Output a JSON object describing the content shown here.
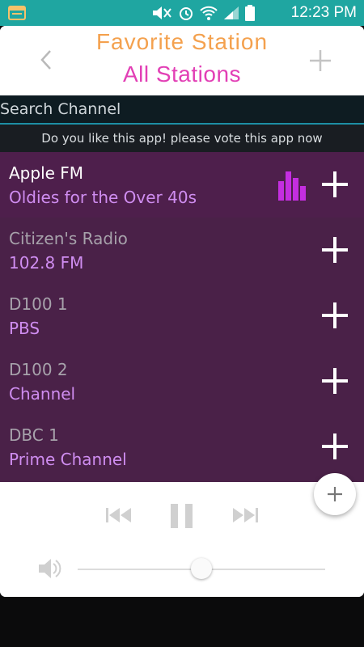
{
  "status_bar": {
    "time": "12:23 PM"
  },
  "header": {
    "title": "Favorite Station",
    "subtitle": "All Stations"
  },
  "search": {
    "placeholder": "Search Channel"
  },
  "vote_banner": "Do you like this app! please vote this app now",
  "stations": [
    {
      "name": "Apple FM",
      "subtitle": "Oldies for the Over 40s",
      "playing": true
    },
    {
      "name": "Citizen's Radio",
      "subtitle": "102.8 FM",
      "playing": false
    },
    {
      "name": "D100 1",
      "subtitle": "PBS",
      "playing": false
    },
    {
      "name": "D100 2",
      "subtitle": "Channel",
      "playing": false
    },
    {
      "name": "DBC 1",
      "subtitle": "Prime Channel",
      "playing": false
    }
  ],
  "player": {
    "volume": 0.5
  },
  "colors": {
    "status_bar": "#1fa6a1",
    "title_orange": "#f4a14e",
    "title_pink": "#e23fb5",
    "list_bg": "#4a2148",
    "subtitle_purple": "#cf8df0",
    "equalizer": "#c42ee0"
  },
  "icons": {
    "back": "chevron-left-icon",
    "add": "plus-icon",
    "playing": "equalizer-icon",
    "previous": "skip-previous-icon",
    "pause": "pause-icon",
    "next": "skip-next-icon",
    "volume": "speaker-icon"
  }
}
